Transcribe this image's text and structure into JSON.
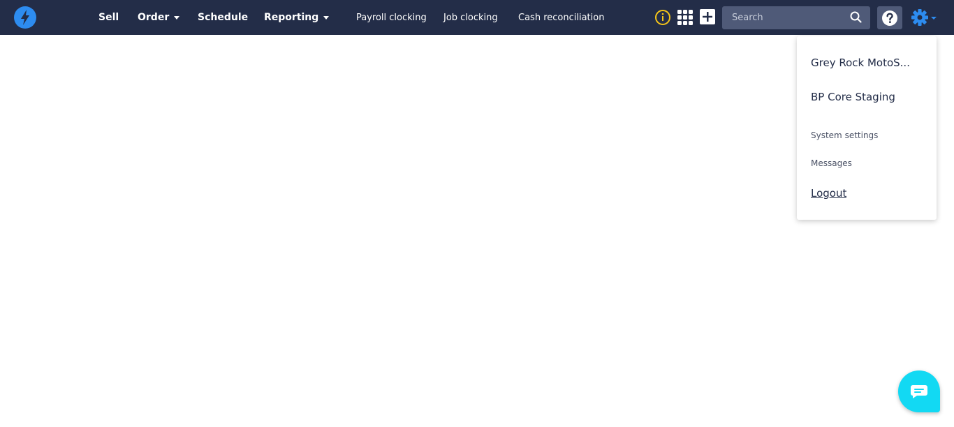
{
  "nav": {
    "main": [
      {
        "label": "Sell",
        "has_caret": false
      },
      {
        "label": "Order",
        "has_caret": true
      },
      {
        "label": "Schedule",
        "has_caret": false
      },
      {
        "label": "Reporting",
        "has_caret": true
      }
    ],
    "sub": [
      "Payroll clocking",
      "Job clocking",
      "Cash reconciliation"
    ]
  },
  "icons": {
    "logo": "lightning-bolt-icon",
    "info": "info-circle-icon",
    "apps": "grid-icon",
    "add": "plus-icon",
    "search": "search-icon",
    "help": "question-icon",
    "settings": "gear-icon",
    "chat": "chat-icon"
  },
  "search": {
    "placeholder": "Search",
    "value": ""
  },
  "dropdown": {
    "items": [
      "Grey Rock MotoS...",
      "BP Core Staging",
      "System settings",
      "Messages",
      "Logout"
    ]
  },
  "colors": {
    "topbar": "#232d48",
    "accent": "#2d8cf0",
    "info": "#f5c518",
    "chat": "#12d9f3"
  }
}
